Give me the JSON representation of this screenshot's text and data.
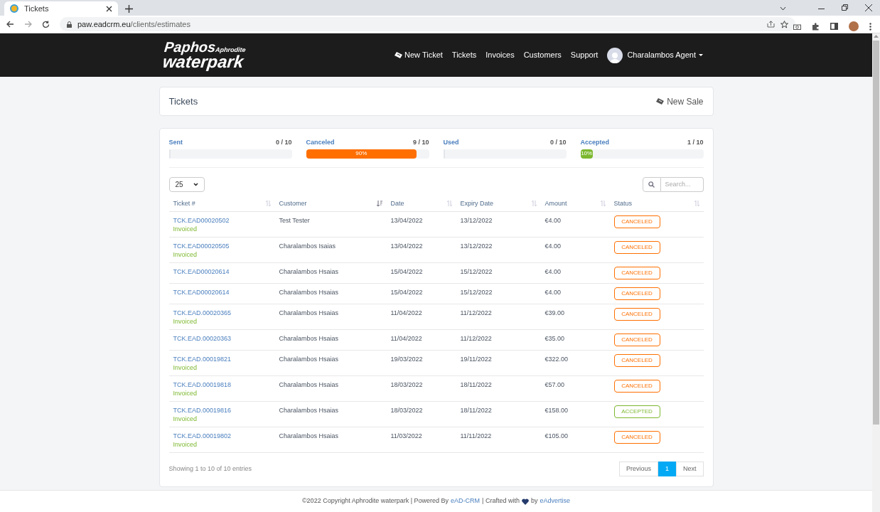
{
  "browser": {
    "tab_title": "Tickets",
    "url_host": "paw.eadcrm.eu",
    "url_path": "/clients/estimates"
  },
  "header": {
    "logo": {
      "line1": "Paphos",
      "line2": "Aphrodite",
      "line3": "waterpark"
    },
    "nav": [
      {
        "label": "New Ticket",
        "kind": "ticket"
      },
      {
        "label": "Tickets",
        "kind": "plain"
      },
      {
        "label": "Invoices",
        "kind": "plain"
      },
      {
        "label": "Customers",
        "kind": "plain"
      },
      {
        "label": "Support",
        "kind": "plain"
      }
    ],
    "user_name": "Charalambos Agent"
  },
  "title_card": {
    "title": "Tickets",
    "action": "New Sale"
  },
  "stats": [
    {
      "label": "Sent",
      "count": "0 / 10",
      "level": 0
    },
    {
      "label": "Canceled",
      "count": "9 / 10",
      "level": 0.9,
      "color": "#ff6f00",
      "value_label": "90%"
    },
    {
      "label": "Used",
      "count": "0 / 10",
      "level": 0
    },
    {
      "label": "Accepted",
      "count": "1 / 10",
      "level": 0.1,
      "color": "#7cb82f",
      "value_label": "10%"
    }
  ],
  "page_size": "25",
  "search": {
    "placeholder": "Search..."
  },
  "columns": [
    {
      "label": "Ticket #",
      "sorted": false
    },
    {
      "label": "Customer",
      "sorted": true
    },
    {
      "label": "Date",
      "sorted": false
    },
    {
      "label": "Expiry Date",
      "sorted": false
    },
    {
      "label": "Amount",
      "sorted": false
    },
    {
      "label": "Status",
      "sorted": false
    }
  ],
  "rows": [
    {
      "ticket": "TCK.EAD00020502",
      "note": "Invoiced",
      "customer": "Test Tester",
      "date": "13/04/2022",
      "expiry": "13/12/2022",
      "amount": "€4.00",
      "status": "CANCELED",
      "color": "#ff6f00"
    },
    {
      "ticket": "TCK.EAD00020505",
      "note": "Invoiced",
      "customer": "Charalambos Isaias",
      "date": "13/04/2022",
      "expiry": "13/12/2022",
      "amount": "€4.00",
      "status": "CANCELED",
      "color": "#ff6f00"
    },
    {
      "ticket": "TCK.EAD00020614",
      "customer": "Charalambos Hsaias",
      "date": "15/04/2022",
      "expiry": "15/12/2022",
      "amount": "€4.00",
      "status": "CANCELED",
      "color": "#ff6f00"
    },
    {
      "ticket": "TCK.EAD00020614",
      "customer": "Charalambos Hsaias",
      "date": "15/04/2022",
      "expiry": "15/12/2022",
      "amount": "€4.00",
      "status": "CANCELED",
      "color": "#ff6f00"
    },
    {
      "ticket": "TCK.EAD.00020365",
      "note": "Invoiced",
      "customer": "Charalambos Hsaias",
      "date": "11/04/2022",
      "expiry": "11/12/2022",
      "amount": "€39.00",
      "status": "CANCELED",
      "color": "#ff6f00"
    },
    {
      "ticket": "TCK.EAD.00020363",
      "customer": "Charalambos Hsaias",
      "date": "11/04/2022",
      "expiry": "11/12/2022",
      "amount": "€35.00",
      "status": "CANCELED",
      "color": "#ff6f00"
    },
    {
      "ticket": "TCK.EAD.00019821",
      "note": "Invoiced",
      "customer": "Charalambos Hsaias",
      "date": "19/03/2022",
      "expiry": "19/11/2022",
      "amount": "€322.00",
      "status": "CANCELED",
      "color": "#ff6f00"
    },
    {
      "ticket": "TCK.EAD.00019818",
      "note": "Invoiced",
      "customer": "Charalambos Hsaias",
      "date": "18/03/2022",
      "expiry": "18/11/2022",
      "amount": "€57.00",
      "status": "CANCELED",
      "color": "#ff6f00"
    },
    {
      "ticket": "TCK.EAD.00019816",
      "note": "Invoiced",
      "customer": "Charalambos Hsaias",
      "date": "18/03/2022",
      "expiry": "18/11/2022",
      "amount": "€158.00",
      "status": "ACCEPTED",
      "color": "#7cb82f"
    },
    {
      "ticket": "TCK.EAD.00019802",
      "note": "Invoiced",
      "customer": "Charalambos Hsaias",
      "date": "11/03/2022",
      "expiry": "11/11/2022",
      "amount": "€105.00",
      "status": "CANCELED",
      "color": "#ff6f00"
    }
  ],
  "info": "Showing 1 to 10 of 10 entries",
  "pagination": [
    {
      "label": "Previous",
      "selected": false
    },
    {
      "label": "1",
      "selected": true
    },
    {
      "label": "Next",
      "selected": false
    }
  ],
  "footer": {
    "copyright": "©2022 Copyright Aphrodite waterpark | Powered By",
    "link1": "eAD-CRM",
    "middle": "| Crafted with",
    "by": "by",
    "link2": "eAdvertise"
  }
}
